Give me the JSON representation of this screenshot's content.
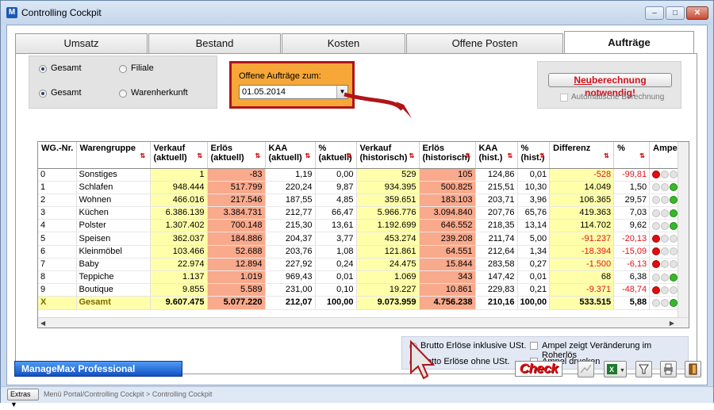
{
  "window": {
    "title": "Controlling Cockpit",
    "min": "–",
    "max": "□",
    "close": "✕"
  },
  "tabs": [
    {
      "label": "Umsatz"
    },
    {
      "label": "Bestand"
    },
    {
      "label": "Kosten"
    },
    {
      "label": "Offene Posten"
    },
    {
      "label": "Aufträge"
    }
  ],
  "filters": {
    "row1": [
      {
        "label": "Gesamt",
        "selected": true
      },
      {
        "label": "Filiale",
        "selected": false
      }
    ],
    "row2": [
      {
        "label": "Gesamt",
        "selected": true
      },
      {
        "label": "Warenherkunft",
        "selected": false
      }
    ]
  },
  "orders": {
    "label": "Offene Aufträge zum:",
    "date": "01.05.2014"
  },
  "recalc": {
    "button": "Neuberechnung notwendig!",
    "auto_label": "Automatische Berechnung"
  },
  "table": {
    "headers": [
      {
        "l1": "WG.-Nr.",
        "l2": ""
      },
      {
        "l1": "Warengruppe",
        "l2": ""
      },
      {
        "l1": "Verkauf",
        "l2": "(aktuell)"
      },
      {
        "l1": "Erlös",
        "l2": "(aktuell)"
      },
      {
        "l1": "KAA",
        "l2": "(aktuell)"
      },
      {
        "l1": "%",
        "l2": "(aktuell)"
      },
      {
        "l1": "Verkauf",
        "l2": "(historisch)"
      },
      {
        "l1": "Erlös",
        "l2": "(historisch)"
      },
      {
        "l1": "KAA",
        "l2": "(hist.)"
      },
      {
        "l1": "%",
        "l2": "(hist.)"
      },
      {
        "l1": "Differenz",
        "l2": ""
      },
      {
        "l1": "%",
        "l2": ""
      },
      {
        "l1": "Ampel",
        "l2": ""
      }
    ],
    "rows": [
      {
        "nr": "0",
        "grp": "Sonstiges",
        "v": "1",
        "e": "-83",
        "kaa": "1,19",
        "p": "0,00",
        "vh": "529",
        "eh": "105",
        "kh": "124,86",
        "ph": "0,01",
        "diff": "-528",
        "dp": "-99,81",
        "amp": [
          "red",
          "grey",
          "grey"
        ]
      },
      {
        "nr": "1",
        "grp": "Schlafen",
        "v": "948.444",
        "e": "517.799",
        "kaa": "220,24",
        "p": "9,87",
        "vh": "934.395",
        "eh": "500.825",
        "kh": "215,51",
        "ph": "10,30",
        "diff": "14.049",
        "dp": "1,50",
        "amp": [
          "grey",
          "grey",
          "green"
        ]
      },
      {
        "nr": "2",
        "grp": "Wohnen",
        "v": "466.016",
        "e": "217.546",
        "kaa": "187,55",
        "p": "4,85",
        "vh": "359.651",
        "eh": "183.103",
        "kh": "203,71",
        "ph": "3,96",
        "diff": "106.365",
        "dp": "29,57",
        "amp": [
          "grey",
          "grey",
          "green"
        ]
      },
      {
        "nr": "3",
        "grp": "Küchen",
        "v": "6.386.139",
        "e": "3.384.731",
        "kaa": "212,77",
        "p": "66,47",
        "vh": "5.966.776",
        "eh": "3.094.840",
        "kh": "207,76",
        "ph": "65,76",
        "diff": "419.363",
        "dp": "7,03",
        "amp": [
          "grey",
          "grey",
          "green"
        ]
      },
      {
        "nr": "4",
        "grp": "Polster",
        "v": "1.307.402",
        "e": "700.148",
        "kaa": "215,30",
        "p": "13,61",
        "vh": "1.192.699",
        "eh": "646.552",
        "kh": "218,35",
        "ph": "13,14",
        "diff": "114.702",
        "dp": "9,62",
        "amp": [
          "grey",
          "grey",
          "green"
        ]
      },
      {
        "nr": "5",
        "grp": "Speisen",
        "v": "362.037",
        "e": "184.886",
        "kaa": "204,37",
        "p": "3,77",
        "vh": "453.274",
        "eh": "239.208",
        "kh": "211,74",
        "ph": "5,00",
        "diff": "-91.237",
        "dp": "-20,13",
        "amp": [
          "red",
          "grey",
          "grey"
        ]
      },
      {
        "nr": "6",
        "grp": "Kleinmöbel",
        "v": "103.466",
        "e": "52.688",
        "kaa": "203,76",
        "p": "1,08",
        "vh": "121.861",
        "eh": "64.551",
        "kh": "212,64",
        "ph": "1,34",
        "diff": "-18.394",
        "dp": "-15,09",
        "amp": [
          "red",
          "grey",
          "grey"
        ]
      },
      {
        "nr": "7",
        "grp": "Baby",
        "v": "22.974",
        "e": "12.894",
        "kaa": "227,92",
        "p": "0,24",
        "vh": "24.475",
        "eh": "15.844",
        "kh": "283,58",
        "ph": "0,27",
        "diff": "-1.500",
        "dp": "-6,13",
        "amp": [
          "red",
          "grey",
          "grey"
        ]
      },
      {
        "nr": "8",
        "grp": "Teppiche",
        "v": "1.137",
        "e": "1.019",
        "kaa": "969,43",
        "p": "0,01",
        "vh": "1.069",
        "eh": "343",
        "kh": "147,42",
        "ph": "0,01",
        "diff": "68",
        "dp": "6,38",
        "amp": [
          "grey",
          "grey",
          "green"
        ]
      },
      {
        "nr": "9",
        "grp": "Boutique",
        "v": "9.855",
        "e": "5.589",
        "kaa": "231,00",
        "p": "0,10",
        "vh": "19.227",
        "eh": "10.861",
        "kh": "229,83",
        "ph": "0,21",
        "diff": "-9.371",
        "dp": "-48,74",
        "amp": [
          "red",
          "grey",
          "grey"
        ]
      }
    ],
    "total": {
      "nr": "X",
      "grp": "Gesamt",
      "v": "9.607.475",
      "e": "5.077.220",
      "kaa": "212,07",
      "p": "100,00",
      "vh": "9.073.959",
      "eh": "4.756.238",
      "kh": "210,16",
      "ph": "100,00",
      "diff": "533.515",
      "dp": "5,88",
      "amp": [
        "grey",
        "grey",
        "green"
      ]
    }
  },
  "options": {
    "brutto": "Brutto Erlöse inklusive USt.",
    "netto": "Netto Erlöse ohne USt.",
    "ampel_change": "Ampel zeigt Veränderung im Roherlös",
    "ampel_print": "Ampel drucken"
  },
  "footer": {
    "logo": "ManageMax Professional",
    "check": "Check"
  },
  "statusbar": {
    "extras": "Extras",
    "breadcrumb": "Menü Portal/Controlling Cockpit > Controlling Cockpit"
  },
  "colors": {
    "highlight_border": "#b01419",
    "orange": "#f7a738",
    "yellow_cell": "#ffffa9",
    "red_cell": "#f9a98c",
    "negative": "#e0131c"
  }
}
